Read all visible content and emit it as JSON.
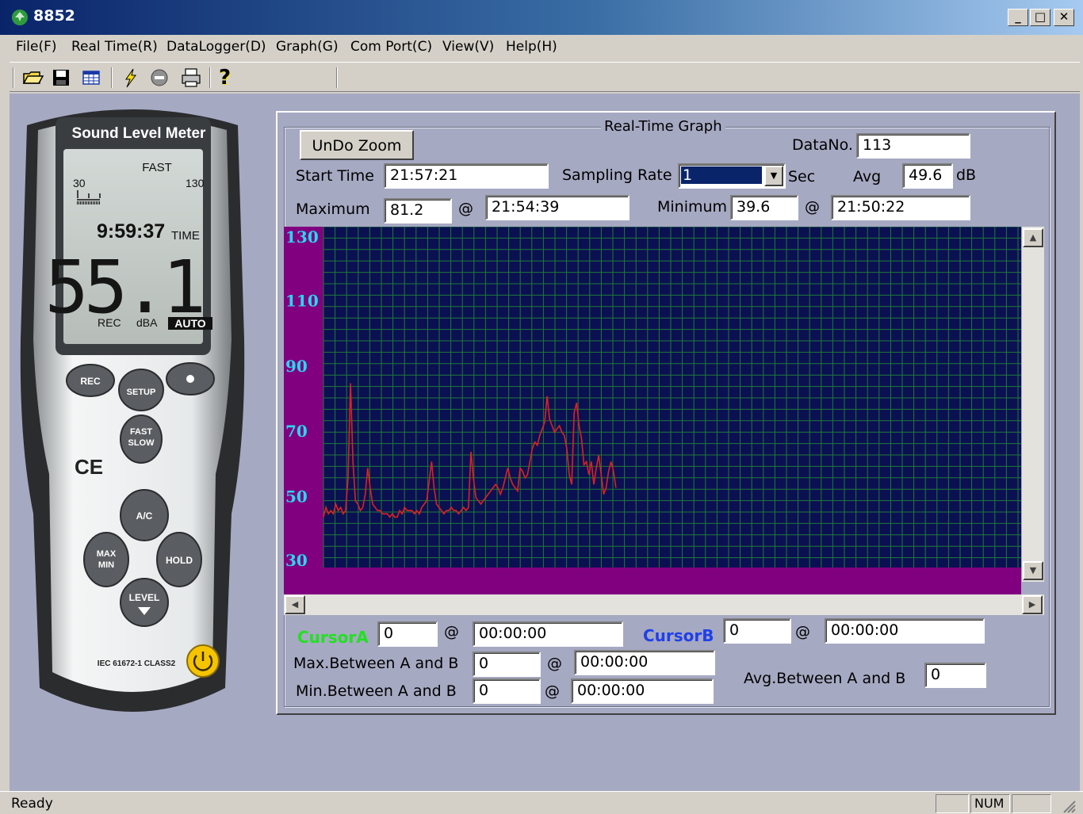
{
  "window": {
    "title": "8852",
    "min_glyph": "_",
    "max_glyph": "□",
    "close_glyph": "✕"
  },
  "menu": [
    "File(F)",
    "Real Time(R)",
    "DataLogger(D)",
    "Graph(G)",
    "Com Port(C)",
    "View(V)",
    "Help(H)"
  ],
  "toolbar": {
    "icons": [
      "open-folder-icon",
      "save-icon",
      "table-icon",
      "lightning-icon",
      "stop-icon",
      "print-icon",
      "help-icon"
    ],
    "help_glyph": "?"
  },
  "meter": {
    "brand_label": "Sound Level Meter",
    "mode": "FAST",
    "range_low": "30",
    "range_high": "130",
    "time": "9:59:37",
    "time_label": "TIME",
    "reading": "55.1",
    "status_rec": "REC",
    "status_unit": "dBA",
    "status_auto": "AUTO",
    "buttons": {
      "rec": "REC",
      "setup": "SETUP",
      "fast": "FAST",
      "slow": "SLOW",
      "ac": "A/C",
      "max": "MAX",
      "min": "MIN",
      "hold": "HOLD",
      "level": "LEVEL"
    },
    "ce_mark": "CE",
    "class_label": "IEC 61672-1 CLASS2"
  },
  "panel": {
    "group_title": "Real-Time Graph",
    "undo_zoom": "UnDo Zoom",
    "data_no_label": "DataNo.",
    "data_no": "113",
    "start_time_label": "Start Time",
    "start_time": "21:57:21",
    "sampling_rate_label": "Sampling Rate",
    "sampling_rate": "1",
    "sec_label": "Sec",
    "avg_label": "Avg",
    "avg": "49.6",
    "db_label": "dB",
    "maximum_label": "Maximum",
    "maximum": "81.2",
    "max_at": "21:54:39",
    "minimum_label": "Minimum",
    "minimum": "39.6",
    "min_at": "21:50:22",
    "at_symbol": "@"
  },
  "cursors": {
    "a_label": "CursorA",
    "a_value": "0",
    "a_time": "00:00:00",
    "b_label": "CursorB",
    "b_value": "0",
    "b_time": "00:00:00",
    "max_between_label": "Max.Between A and B",
    "max_between": "0",
    "max_between_time": "00:00:00",
    "min_between_label": "Min.Between A and B",
    "min_between": "0",
    "min_between_time": "00:00:00",
    "avg_between_label": "Avg.Between A and B",
    "avg_between": "0"
  },
  "status": {
    "text": "Ready",
    "num": "NUM"
  },
  "colors": {
    "plot_bg": "#0b1052",
    "grid": "#1f7a38",
    "trace": "#e02020",
    "axis_band": "#800080",
    "axis_text": "#27d8f0"
  },
  "chart_data": {
    "type": "line",
    "ylim": [
      30,
      130
    ],
    "yticks": [
      130,
      110,
      90,
      70,
      50,
      30
    ],
    "x_per_sample_px_note": "",
    "series": [
      {
        "values": [
          43,
          46,
          44,
          45,
          44,
          47,
          45,
          46,
          44,
          45,
          55,
          84,
          60,
          48,
          47,
          45,
          46,
          50,
          58,
          52,
          47,
          46,
          45,
          45,
          44,
          44,
          44,
          43,
          44,
          43,
          43,
          45,
          44,
          46,
          45,
          45,
          45,
          44,
          45,
          44,
          46,
          47,
          48,
          54,
          60,
          52,
          47,
          46,
          45,
          44,
          45,
          45,
          46,
          45,
          45,
          44,
          45,
          46,
          45,
          46,
          63,
          55,
          49,
          48,
          47,
          48,
          49,
          50,
          51,
          52,
          53,
          52,
          50,
          52,
          55,
          58,
          55,
          53,
          52,
          51,
          58,
          57,
          55,
          56,
          60,
          64,
          66,
          65,
          68,
          70,
          72,
          80,
          73,
          71,
          69,
          70,
          71,
          69,
          68,
          64,
          56,
          53,
          75,
          78,
          71,
          67,
          59,
          60,
          56,
          60,
          53,
          58,
          62,
          56,
          50,
          52,
          57,
          60,
          57,
          52
        ]
      }
    ]
  }
}
